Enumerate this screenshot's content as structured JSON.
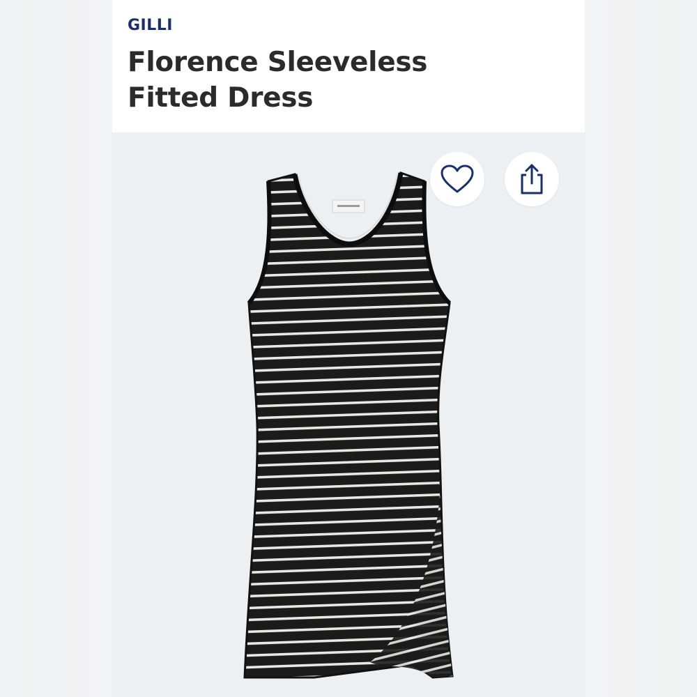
{
  "product": {
    "brand": "GILLI",
    "title": "Florence Sleeveless Fitted Dress"
  },
  "actions": {
    "favorite_icon": "heart-icon",
    "share_icon": "share-icon"
  },
  "colors": {
    "brand_text": "#1a2e6b",
    "title_text": "#2b2b2b",
    "image_background": "#edf0f2",
    "icon_stroke": "#1a2e6b"
  }
}
